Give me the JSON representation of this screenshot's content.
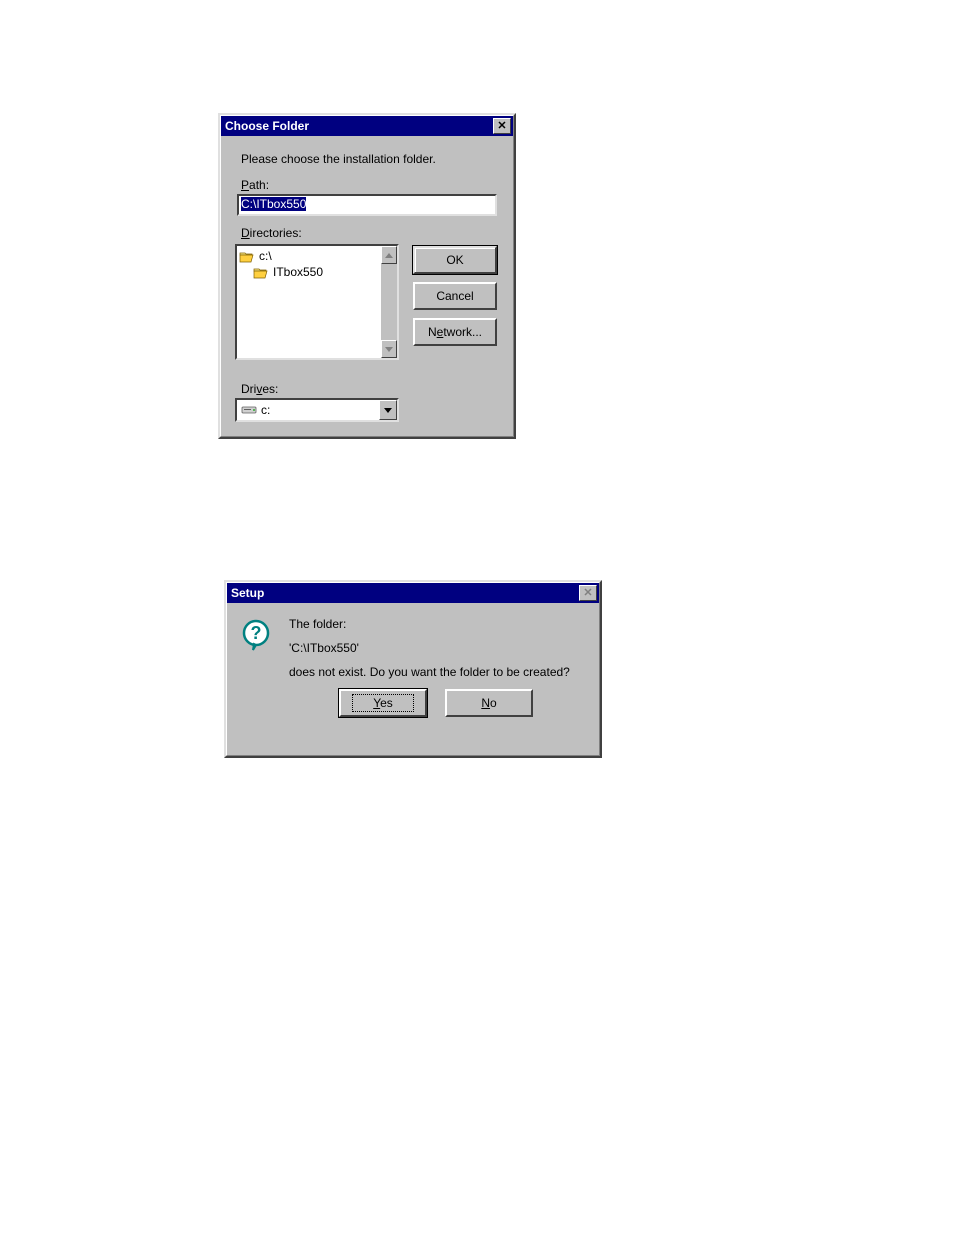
{
  "dialog1": {
    "title": "Choose Folder",
    "instruction": "Please choose the installation folder.",
    "path_label": "Path:",
    "path_value": "C:\\ITbox550",
    "directories_label": "Directories:",
    "tree": [
      {
        "icon": "folder-open-icon",
        "label": "c:\\"
      },
      {
        "icon": "folder-open-icon",
        "label": "ITbox550",
        "indent": true
      }
    ],
    "buttons": {
      "ok": "OK",
      "cancel": "Cancel",
      "network": "Network..."
    },
    "drives_label": "Drives:",
    "drive_selected": "c:"
  },
  "dialog2": {
    "title": "Setup",
    "line1": "The folder:",
    "line2": "'C:\\ITbox550'",
    "line3": "does not exist.  Do you want the folder to be created?",
    "yes": "Yes",
    "no": "No"
  }
}
